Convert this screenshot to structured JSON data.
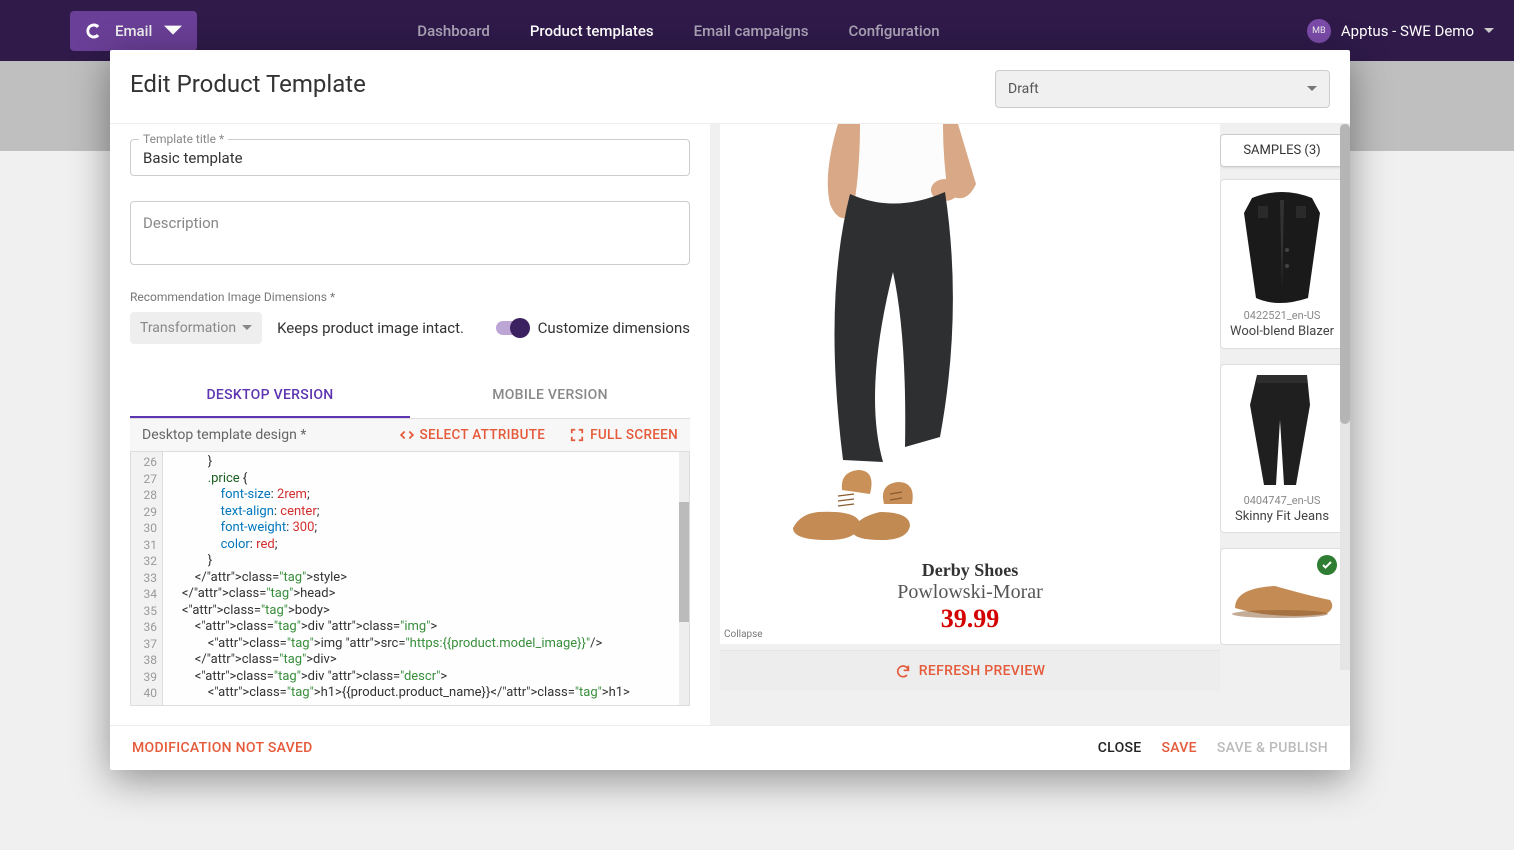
{
  "nav": {
    "brand": "Email",
    "links": [
      "Dashboard",
      "Product templates",
      "Email campaigns",
      "Configuration"
    ],
    "active_index": 1,
    "account": "Apptus - SWE Demo",
    "avatar_initials": "MB"
  },
  "modal": {
    "title": "Edit Product Template",
    "status": "Draft",
    "form": {
      "title_label": "Template title *",
      "title_value": "Basic template",
      "description_placeholder": "Description",
      "description_value": "",
      "dim_label": "Recommendation Image Dimensions *",
      "transformation_label": "Transformation",
      "keeps_label": "Keeps product image intact.",
      "customize_label": "Customize dimensions"
    },
    "tabs": {
      "desktop": "DESKTOP VERSION",
      "mobile": "MOBILE VERSION"
    },
    "editor": {
      "label": "Desktop template design *",
      "select_attr": "SELECT ATTRIBUTE",
      "full_screen": "FULL SCREEN",
      "line_start": 26,
      "lines": [
        "            }",
        "            .price {",
        "                font-size: 2rem;",
        "                text-align: center;",
        "                font-weight: 300;",
        "                color: red;",
        "            }",
        "        </style>",
        "    </head>",
        "    <body>",
        "        <div class=\"img\">",
        "            <img src=\"https:{{product.model_image}}\"/>",
        "        </div>",
        "        <div class=\"descr\">",
        "            <h1>{{product.product_name}}</h1>"
      ]
    },
    "preview": {
      "product_name": "Derby Shoes",
      "brand": "Powlowski-Morar",
      "price": "39.99",
      "collapse": "Collapse",
      "refresh": "REFRESH PREVIEW"
    },
    "samples": {
      "button": "SAMPLES (3)",
      "items": [
        {
          "id": "0422521_en-US",
          "name": "Wool-blend Blazer",
          "selected": false,
          "kind": "blazer"
        },
        {
          "id": "0404747_en-US",
          "name": "Skinny Fit Jeans",
          "selected": false,
          "kind": "jeans"
        },
        {
          "id": "",
          "name": "",
          "selected": true,
          "kind": "shoe"
        }
      ]
    },
    "footer": {
      "warn": "MODIFICATION NOT SAVED",
      "close": "CLOSE",
      "save": "SAVE",
      "publish": "SAVE & PUBLISH"
    }
  }
}
